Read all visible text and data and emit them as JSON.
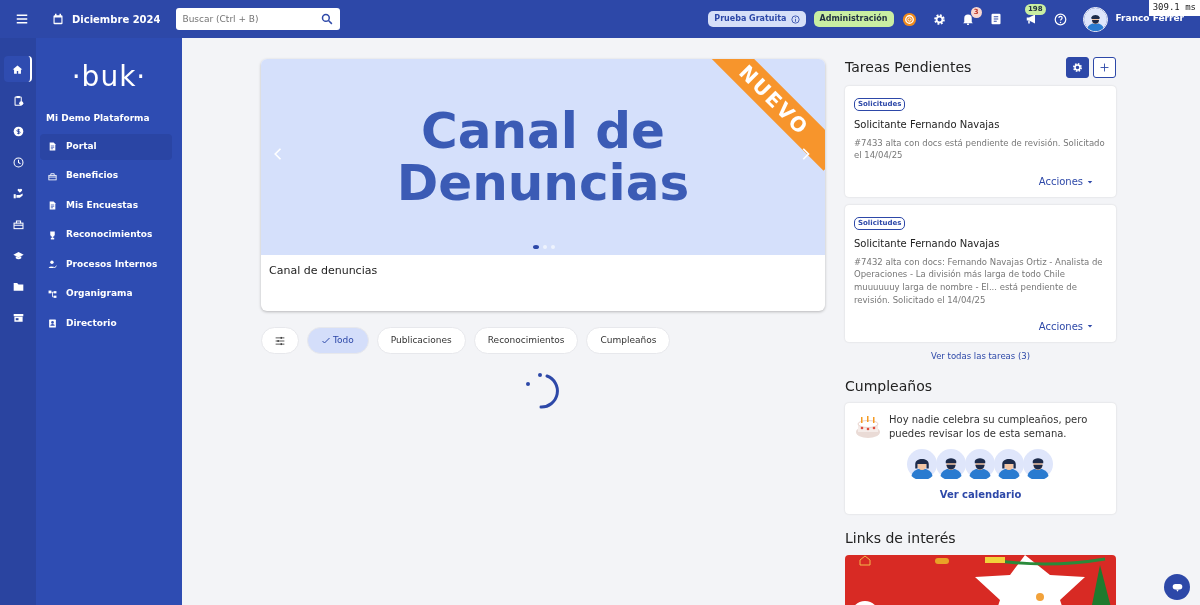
{
  "topbar": {
    "month": "Diciembre 2024",
    "search": {
      "placeholder": "Buscar (Ctrl + B)"
    },
    "trial_badge": "Prueba Gratuita",
    "admin_badge": "Administración",
    "notifications_count": "3",
    "messages_count": "198",
    "user_name": "Franco Ferrer"
  },
  "timing_overlay": "309.1 ms",
  "rail": [
    {
      "kind": "home",
      "selected": true
    },
    {
      "kind": "clipboard",
      "selected": false
    },
    {
      "kind": "dollar",
      "selected": false
    },
    {
      "kind": "clock",
      "selected": false
    },
    {
      "kind": "hand",
      "selected": false
    },
    {
      "kind": "gift",
      "selected": false
    },
    {
      "kind": "cap",
      "selected": false
    },
    {
      "kind": "folder",
      "selected": false
    },
    {
      "kind": "store",
      "selected": false
    }
  ],
  "sidebar": {
    "logo": "·buk·",
    "title": "Mi Demo Plataforma",
    "items": [
      {
        "label": "Portal",
        "kind": "doc",
        "selected": true
      },
      {
        "label": "Beneficios",
        "kind": "gift",
        "selected": false
      },
      {
        "label": "Mis Encuestas",
        "kind": "doc",
        "selected": false
      },
      {
        "label": "Reconocimientos",
        "kind": "trophy",
        "selected": false
      },
      {
        "label": "Procesos Internos",
        "kind": "person",
        "selected": false
      },
      {
        "label": "Organigrama",
        "kind": "org",
        "selected": false
      },
      {
        "label": "Directorio",
        "kind": "contact",
        "selected": false
      }
    ]
  },
  "carousel": {
    "banner": {
      "headline": "Canal de Denuncias",
      "ribbon": "NUEVO"
    },
    "dots": [
      {
        "selected": true
      },
      {
        "selected": false
      },
      {
        "selected": false
      }
    ],
    "caption": "Canal de denuncias"
  },
  "filters": [
    {
      "label": "Todo",
      "selected": true
    },
    {
      "label": "Publicaciones",
      "selected": false
    },
    {
      "label": "Reconocimientos",
      "selected": false
    },
    {
      "label": "Cumpleaños",
      "selected": false
    }
  ],
  "tasks": {
    "title": "Tareas Pendientes",
    "items": [
      {
        "tag": "Solicitudes",
        "title": "Solicitante Fernando Navajas",
        "description": "#7433 alta con docs está pendiente de revisión. Solicitado el 14/04/25",
        "action": "Acciones"
      },
      {
        "tag": "Solicitudes",
        "title": "Solicitante Fernando Navajas",
        "description": "#7432 alta con docs: Fernando Navajas Ortiz - Analista de Operaciones - La división más larga de todo Chile muuuuuuy larga de nombre - El... está pendiente de revisión. Solicitado el 14/04/25",
        "action": "Acciones"
      }
    ],
    "view_all": "Ver todas las tareas (3)"
  },
  "birthdays": {
    "title": "Cumpleaños",
    "message": "Hoy nadie celebra su cumpleaños, pero puedes revisar los de esta semana.",
    "people": [
      {
        "kind": "woman"
      },
      {
        "kind": "man"
      },
      {
        "kind": "man"
      },
      {
        "kind": "woman"
      },
      {
        "kind": "man"
      }
    ],
    "link": "Ver calendario"
  },
  "links": {
    "title": "Links de interés"
  }
}
